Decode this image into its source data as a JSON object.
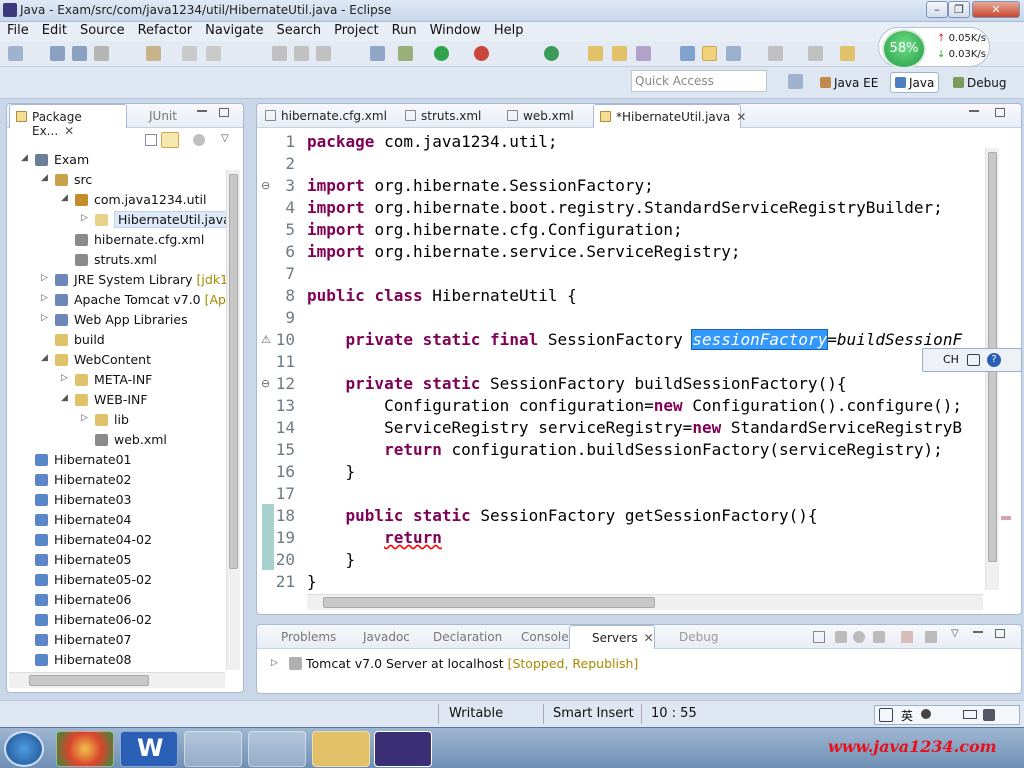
{
  "window": {
    "title": "Java - Exam/src/com/java1234/util/HibernateUtil.java - Eclipse",
    "min": "–",
    "restore": "❐",
    "close": "✕"
  },
  "menu": [
    "File",
    "Edit",
    "Source",
    "Refactor",
    "Navigate",
    "Search",
    "Project",
    "Run",
    "Window",
    "Help"
  ],
  "quick_access": {
    "placeholder": "Quick Access"
  },
  "perspectives": [
    {
      "label": "Java EE"
    },
    {
      "label": "Java"
    },
    {
      "label": "Debug"
    }
  ],
  "net": {
    "percent": "58%",
    "up": "0.05K/s",
    "down": "0.03K/s"
  },
  "package_explorer": {
    "tab": "Package Ex...",
    "tab2": "JUnit",
    "items": [
      {
        "label": "Exam",
        "depth": 0,
        "arrow": "◢",
        "color": "#6b7f99"
      },
      {
        "label": "src",
        "depth": 1,
        "arrow": "◢",
        "color": "#c9a14a"
      },
      {
        "label": "com.java1234.util",
        "depth": 2,
        "arrow": "◢",
        "color": "#c48b2b"
      },
      {
        "label": "HibernateUtil.java",
        "depth": 3,
        "arrow": "▷",
        "color": "#e7d28a",
        "selected": true
      },
      {
        "label": "hibernate.cfg.xml",
        "depth": 2,
        "arrow": "",
        "color": "#8a8a8a"
      },
      {
        "label": "struts.xml",
        "depth": 2,
        "arrow": "",
        "color": "#8a8a8a"
      },
      {
        "label": "JRE System Library",
        "decor": "[jdk1.(",
        "depth": 1,
        "arrow": "▷",
        "color": "#6d87b8"
      },
      {
        "label": "Apache Tomcat v7.0",
        "decor": "[Apa",
        "depth": 1,
        "arrow": "▷",
        "color": "#6d87b8"
      },
      {
        "label": "Web App Libraries",
        "depth": 1,
        "arrow": "▷",
        "color": "#6d87b8"
      },
      {
        "label": "build",
        "depth": 1,
        "arrow": "",
        "color": "#e0c26a"
      },
      {
        "label": "WebContent",
        "depth": 1,
        "arrow": "◢",
        "color": "#e0c26a"
      },
      {
        "label": "META-INF",
        "depth": 2,
        "arrow": "▷",
        "color": "#e0c26a"
      },
      {
        "label": "WEB-INF",
        "depth": 2,
        "arrow": "◢",
        "color": "#e0c26a"
      },
      {
        "label": "lib",
        "depth": 3,
        "arrow": "▷",
        "color": "#e0c26a"
      },
      {
        "label": "web.xml",
        "depth": 3,
        "arrow": "",
        "color": "#8a8a8a"
      },
      {
        "label": "Hibernate01",
        "depth": 0,
        "arrow": "",
        "color": "#5a86c7"
      },
      {
        "label": "Hibernate02",
        "depth": 0,
        "arrow": "",
        "color": "#5a86c7"
      },
      {
        "label": "Hibernate03",
        "depth": 0,
        "arrow": "",
        "color": "#5a86c7"
      },
      {
        "label": "Hibernate04",
        "depth": 0,
        "arrow": "",
        "color": "#5a86c7"
      },
      {
        "label": "Hibernate04-02",
        "depth": 0,
        "arrow": "",
        "color": "#5a86c7"
      },
      {
        "label": "Hibernate05",
        "depth": 0,
        "arrow": "",
        "color": "#5a86c7"
      },
      {
        "label": "Hibernate05-02",
        "depth": 0,
        "arrow": "",
        "color": "#5a86c7"
      },
      {
        "label": "Hibernate06",
        "depth": 0,
        "arrow": "",
        "color": "#5a86c7"
      },
      {
        "label": "Hibernate06-02",
        "depth": 0,
        "arrow": "",
        "color": "#5a86c7"
      },
      {
        "label": "Hibernate07",
        "depth": 0,
        "arrow": "",
        "color": "#5a86c7"
      },
      {
        "label": "Hibernate08",
        "depth": 0,
        "arrow": "",
        "color": "#5a86c7"
      }
    ]
  },
  "editor": {
    "tabs": [
      {
        "label": "hibernate.cfg.xml"
      },
      {
        "label": "struts.xml"
      },
      {
        "label": "web.xml"
      },
      {
        "label": "*HibernateUtil.java",
        "active": true
      }
    ],
    "lines": [
      {
        "n": "1",
        "tokens": [
          [
            "kw",
            "package"
          ],
          [
            "",
            "com.java1234.util;"
          ]
        ]
      },
      {
        "n": "2",
        "tokens": []
      },
      {
        "n": "3",
        "mark": "⊖",
        "tokens": [
          [
            "kw",
            "import"
          ],
          [
            "",
            "org.hibernate.SessionFactory;"
          ]
        ]
      },
      {
        "n": "4",
        "tokens": [
          [
            "kw",
            "import"
          ],
          [
            "",
            "org.hibernate.boot.registry.StandardServiceRegistryBuilder;"
          ]
        ]
      },
      {
        "n": "5",
        "tokens": [
          [
            "kw",
            "import"
          ],
          [
            "",
            "org.hibernate.cfg.Configuration;"
          ]
        ]
      },
      {
        "n": "6",
        "tokens": [
          [
            "kw",
            "import"
          ],
          [
            "",
            "org.hibernate.service.ServiceRegistry;"
          ]
        ]
      },
      {
        "n": "7",
        "tokens": []
      },
      {
        "n": "8",
        "tokens": [
          [
            "kw",
            "public"
          ],
          [
            "kw",
            "class"
          ],
          [
            "",
            "HibernateUtil {"
          ]
        ]
      },
      {
        "n": "9",
        "tokens": []
      },
      {
        "n": "10",
        "mark": "⚠",
        "tokens": [
          [
            "",
            "    "
          ],
          [
            "kw",
            "private"
          ],
          [
            "kw",
            "static"
          ],
          [
            "kw",
            "final"
          ],
          [
            "",
            "SessionFactory "
          ],
          [
            "sel",
            "sessionFactory"
          ],
          [
            "ital",
            "=buildSessionF"
          ]
        ]
      },
      {
        "n": "11",
        "tokens": []
      },
      {
        "n": "12",
        "mark": "⊖",
        "tokens": [
          [
            "",
            "    "
          ],
          [
            "kw",
            "private"
          ],
          [
            "kw",
            "static"
          ],
          [
            "",
            "SessionFactory buildSessionFactory(){"
          ]
        ]
      },
      {
        "n": "13",
        "tokens": [
          [
            "",
            "        Configuration configuration="
          ],
          [
            "kw",
            "new"
          ],
          [
            "",
            "Configuration().configure();"
          ]
        ]
      },
      {
        "n": "14",
        "tokens": [
          [
            "",
            "        ServiceRegistry serviceRegistry="
          ],
          [
            "kw",
            "new"
          ],
          [
            "",
            "StandardServiceRegistryB"
          ]
        ]
      },
      {
        "n": "15",
        "tokens": [
          [
            "",
            "        "
          ],
          [
            "kw",
            "return"
          ],
          [
            "",
            "configuration.buildSessionFactory(serviceRegistry);"
          ]
        ]
      },
      {
        "n": "16",
        "tokens": [
          [
            "",
            "    }"
          ]
        ]
      },
      {
        "n": "17",
        "tokens": []
      },
      {
        "n": "18",
        "tokens": [
          [
            "",
            "    "
          ],
          [
            "kw",
            "public"
          ],
          [
            "kw",
            "static"
          ],
          [
            "",
            "SessionFactory getSessionFactory(){"
          ]
        ]
      },
      {
        "n": "19",
        "mark": "✖",
        "tokens": [
          [
            "",
            "        "
          ],
          [
            "kwerr",
            "return"
          ]
        ]
      },
      {
        "n": "20",
        "tokens": [
          [
            "",
            "    }"
          ]
        ]
      },
      {
        "n": "21",
        "tokens": [
          [
            "",
            "}"
          ]
        ]
      }
    ]
  },
  "bottom": {
    "tabs": [
      {
        "label": "Problems"
      },
      {
        "label": "Javadoc"
      },
      {
        "label": "Declaration"
      },
      {
        "label": "Console"
      },
      {
        "label": "Servers",
        "active": true
      },
      {
        "label": "Debug"
      }
    ],
    "server": "Tomcat v7.0 Server at localhost",
    "server_state": "[Stopped, Republish]"
  },
  "ime": {
    "label": "CH"
  },
  "status": {
    "writable": "Writable",
    "insert": "Smart Insert",
    "pos": "10 : 55"
  },
  "watermark": "www.java1234.com"
}
